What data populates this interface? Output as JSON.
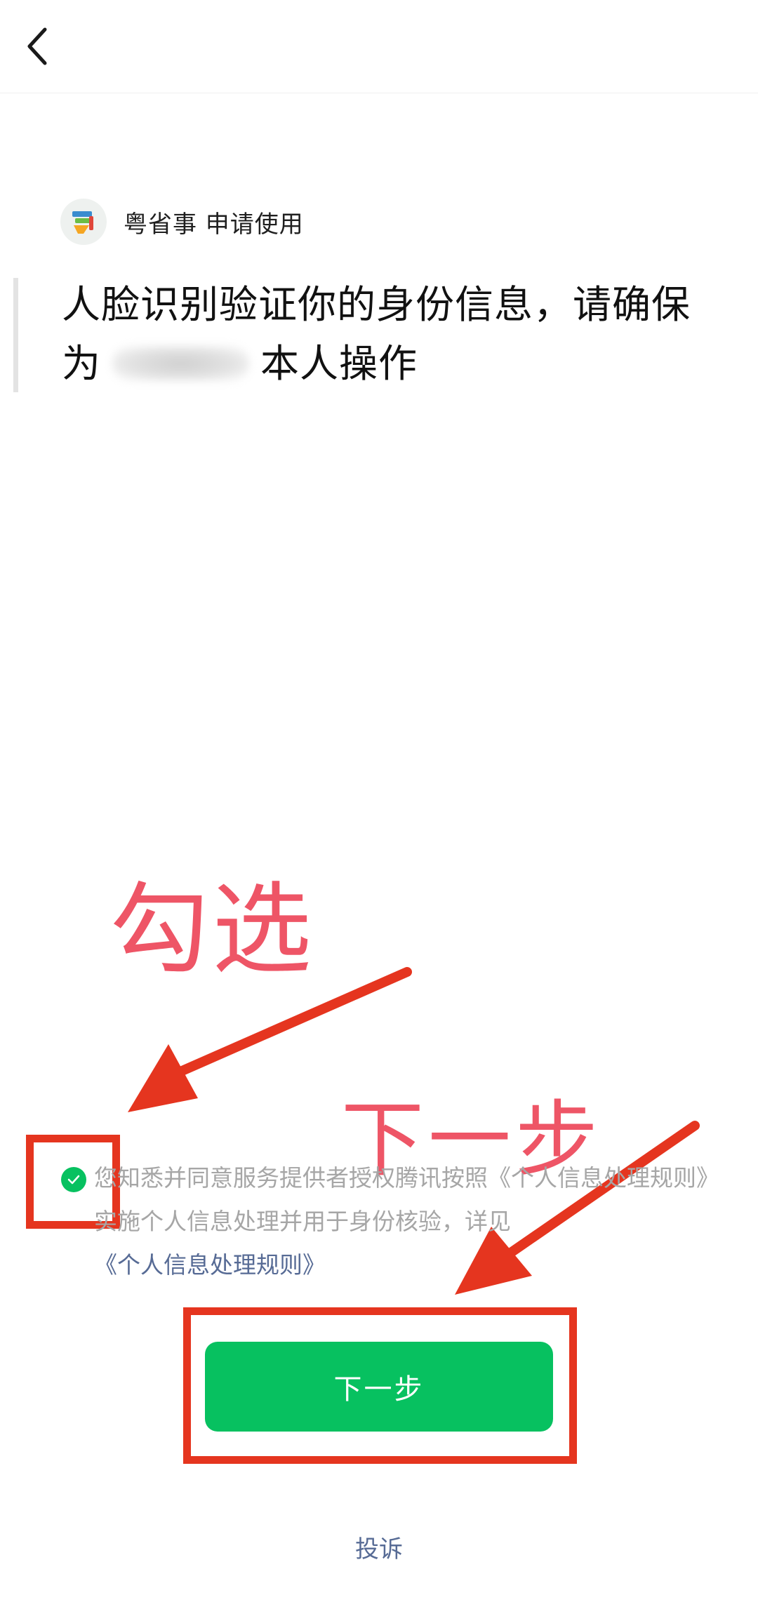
{
  "nav": {
    "back_icon": "chevron-left-icon"
  },
  "app": {
    "logo_icon": "yue-app-logo-icon",
    "request_text": "粤省事 申请使用"
  },
  "headline": {
    "line_before_name": "人脸识别验证你的身份信息，请确保为",
    "line_after_name": "本人操作"
  },
  "annotations": {
    "checkbox_hint": "勾选",
    "button_hint": "下一步",
    "highlight_color": "#e5351f",
    "text_color": "#ee5566"
  },
  "consent": {
    "checked": true,
    "text": "您知悉并同意服务提供者授权腾讯按照《个人信息处理规则》实施个人信息处理并用于身份核验，详见",
    "link_text": "《个人信息处理规则》"
  },
  "primary_button": {
    "label": "下一步",
    "color": "#07c160"
  },
  "footer": {
    "complain_label": "投诉"
  }
}
